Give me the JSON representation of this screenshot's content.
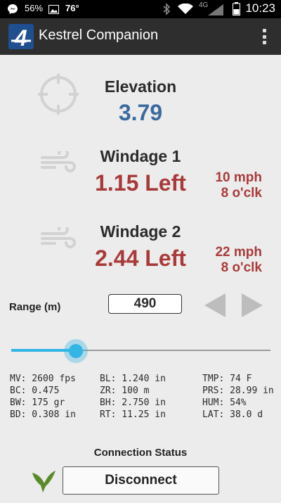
{
  "status_bar": {
    "battery_left": "56%",
    "temperature": "76°",
    "network": "4G",
    "time": "10:23"
  },
  "app_bar": {
    "title": "Kestrel Companion",
    "logo_glyph": "4"
  },
  "elevation": {
    "label": "Elevation",
    "value": "3.79"
  },
  "windage1": {
    "label": "Windage 1",
    "value": "1.15 Left",
    "speed": "10 mph",
    "direction": "8 o'clk"
  },
  "windage2": {
    "label": "Windage 2",
    "value": "2.44 Left",
    "speed": "22 mph",
    "direction": "8 o'clk"
  },
  "range": {
    "label": "Range (m)",
    "value": "490",
    "slider_fraction": 0.25
  },
  "params": {
    "col1": [
      "MV: 2600 fps",
      "BC: 0.475",
      "BW: 175 gr",
      "BD: 0.308 in"
    ],
    "col2": [
      "BL: 1.240 in",
      "ZR: 100 m",
      "BH: 2.750 in",
      "RT: 11.25 in"
    ],
    "col3": [
      "TMP: 74 F",
      "PRS: 28.99 in",
      "HUM: 54%",
      "LAT: 38.0 d"
    ]
  },
  "connection": {
    "title": "Connection Status",
    "button_label": "Disconnect"
  },
  "colors": {
    "accent": "#33b5e5",
    "elevation_value": "#3a6a9e",
    "windage_value": "#a93a3a",
    "app_bar": "#2e2e2e",
    "connection_icon": "#5a8a2a"
  },
  "icons": {
    "crosshair": "crosshair-icon",
    "wind": "wind-icon",
    "prev": "arrow-left-icon",
    "next": "arrow-right-icon",
    "bird": "kestrel-bird-icon"
  }
}
